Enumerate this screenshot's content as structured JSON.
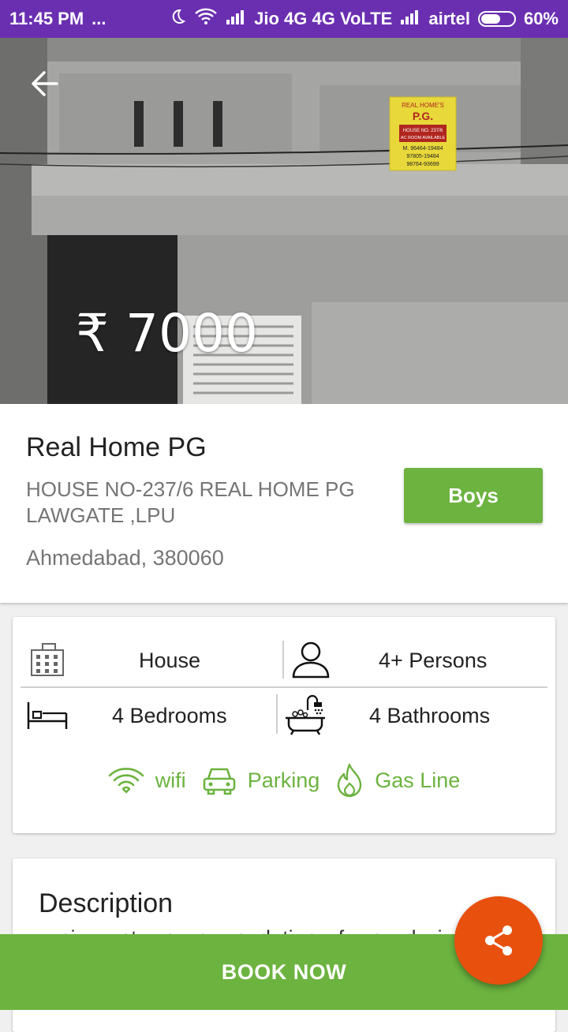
{
  "status_bar": {
    "time": "11:45 PM",
    "dots": "...",
    "carrier1": "Jio 4G 4G VoLTE",
    "carrier2": "airtel",
    "battery": "60%",
    "battery_level": 0.6
  },
  "hero": {
    "price": "₹ 7000",
    "sign": {
      "line1": "REAL HOME'S",
      "line2": "P.G.",
      "line3": "HOUSE NO. 237/6",
      "line4": "AC ROOM AVAILABLE",
      "line5": "M. 96464-19484",
      "line6": "97805-19484",
      "line7": "98764-93699"
    }
  },
  "listing": {
    "name": "Real Home PG",
    "address": "HOUSE NO-237/6 REAL HOME PG LAWGATE ,LPU",
    "city": "Ahmedabad, 380060",
    "gender": "Boys"
  },
  "features": {
    "type": "House",
    "occupancy": "4+ Persons",
    "bedrooms": "4 Bedrooms",
    "bathrooms": "4 Bathrooms"
  },
  "amenities": {
    "wifi": "wifi",
    "parking": "Parking",
    "gas": "Gas Line"
  },
  "description": {
    "title": "Description",
    "body": "…ci..u…ct….a…c….o..d..ti..n…f….o…d…i…"
  },
  "book_label": "BOOK NOW",
  "colors": {
    "status_bar": "#6a2fb1",
    "accent_green": "#6cb33f",
    "fab_orange": "#e8500e"
  }
}
